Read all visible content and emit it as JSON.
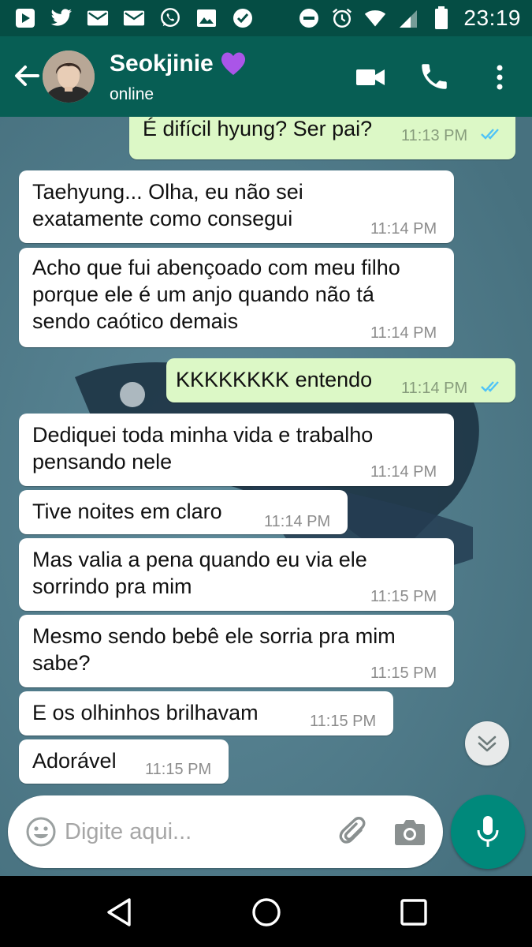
{
  "status_bar": {
    "time": "23:19",
    "left_icons": [
      "play-store-icon",
      "twitter-icon",
      "mail-icon",
      "mail-icon",
      "whatsapp-icon",
      "image-icon",
      "check-bubble-icon"
    ],
    "right_icons": [
      "do-not-disturb-icon",
      "alarm-icon",
      "wifi-icon",
      "signal-icon",
      "battery-icon"
    ]
  },
  "header": {
    "name": "Seokjinie",
    "name_emoji": "purple-heart-icon",
    "status": "online",
    "actions": [
      "video-call-icon",
      "phone-icon",
      "more-vert-icon"
    ]
  },
  "messages": [
    {
      "dir": "out",
      "text": "É difícil hyung? Ser pai?",
      "time": "11:13 PM",
      "read": true
    },
    {
      "dir": "in",
      "text": "Taehyung... Olha, eu não sei\nexatamente como consegui",
      "time": "11:14 PM"
    },
    {
      "dir": "in",
      "text": "Acho que fui abençoado com meu filho\nporque ele é um anjo quando não tá\nsendo caótico demais",
      "time": "11:14 PM"
    },
    {
      "dir": "out",
      "text": "KKKKKKKK entendo",
      "time": "11:14 PM",
      "read": true
    },
    {
      "dir": "in",
      "text": "Dediquei toda minha vida e trabalho\npensando nele",
      "time": "11:14 PM"
    },
    {
      "dir": "in",
      "text": "Tive noites em claro",
      "time": "11:14 PM"
    },
    {
      "dir": "in",
      "text": "Mas valia a pena quando eu via ele\nsorrindo pra mim",
      "time": "11:15 PM"
    },
    {
      "dir": "in",
      "text": "Mesmo sendo bebê ele sorria pra mim\nsabe?",
      "time": "11:15 PM"
    },
    {
      "dir": "in",
      "text": "E os olhinhos brilhavam",
      "time": "11:15 PM"
    },
    {
      "dir": "in",
      "text": "Adorável",
      "time": "11:15 PM"
    }
  ],
  "input": {
    "placeholder": "Digite aqui...",
    "value": ""
  },
  "colors": {
    "header": "#075e54",
    "status_bar": "#054d44",
    "outgoing_bubble": "#dcf8c6",
    "incoming_bubble": "#ffffff",
    "read_ticks": "#4fc3f7",
    "mic_button": "#00897b"
  }
}
